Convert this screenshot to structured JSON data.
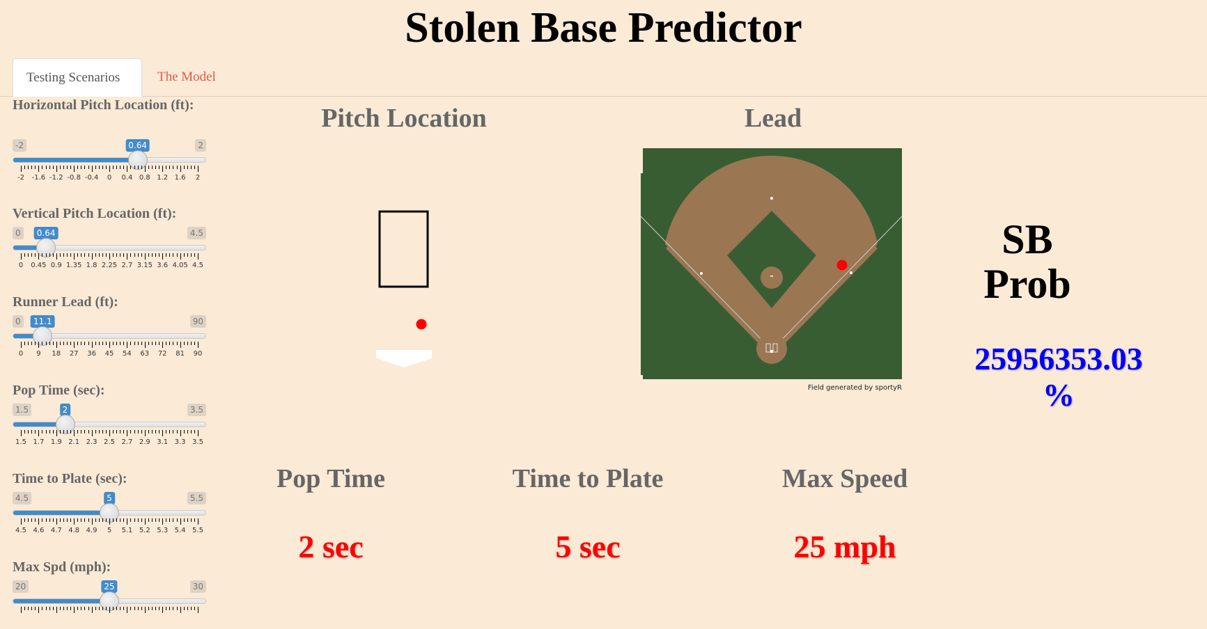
{
  "app": {
    "title": "Stolen Base Predictor"
  },
  "tabs": [
    {
      "label": "Testing Scenarios",
      "active": true
    },
    {
      "label": "The Model",
      "active": false
    }
  ],
  "sliders": [
    {
      "label": "Horizontal Pitch Location (ft):",
      "min": -2,
      "max": 2,
      "value": 0.64,
      "min_label": "-2",
      "max_label": "2",
      "value_label": "0.64",
      "ticks": [
        "-2",
        "-1.6",
        "-1.2",
        "-0.8",
        "-0.4",
        "0",
        "0.4",
        "0.8",
        "1.2",
        "1.6",
        "2"
      ]
    },
    {
      "label": "Vertical Pitch Location (ft):",
      "min": 0,
      "max": 4.5,
      "value": 0.64,
      "min_label": "0",
      "max_label": "4.5",
      "value_label": "0.64",
      "ticks": [
        "0",
        "0.45",
        "0.9",
        "1.35",
        "1.8",
        "2.25",
        "2.7",
        "3.15",
        "3.6",
        "4.05",
        "4.5"
      ]
    },
    {
      "label": "Runner Lead (ft):",
      "min": 0,
      "max": 90,
      "value": 11.1,
      "min_label": "0",
      "max_label": "90",
      "value_label": "11.1",
      "ticks": [
        "0",
        "9",
        "18",
        "27",
        "36",
        "45",
        "54",
        "63",
        "72",
        "81",
        "90"
      ]
    },
    {
      "label": "Pop Time (sec):",
      "min": 1.5,
      "max": 3.5,
      "value": 2,
      "min_label": "1.5",
      "max_label": "3.5",
      "value_label": "2",
      "ticks": [
        "1.5",
        "1.7",
        "1.9",
        "2.1",
        "2.3",
        "2.5",
        "2.7",
        "2.9",
        "3.1",
        "3.3",
        "3.5"
      ]
    },
    {
      "label": "Time to Plate (sec):",
      "min": 4.5,
      "max": 5.5,
      "value": 5,
      "min_label": "4.5",
      "max_label": "5.5",
      "value_label": "5",
      "ticks": [
        "4.5",
        "4.6",
        "4.7",
        "4.8",
        "4.9",
        "5",
        "5.1",
        "5.2",
        "5.3",
        "5.4",
        "5.5"
      ]
    },
    {
      "label": "Max Spd (mph):",
      "min": 20,
      "max": 30,
      "value": 25,
      "min_label": "20",
      "max_label": "30",
      "value_label": "25",
      "ticks": []
    }
  ],
  "panels": {
    "pitch_location": {
      "title": "Pitch Location"
    },
    "lead": {
      "title": "Lead",
      "caption": "Field generated by sportyR"
    },
    "sb_prob": {
      "label": "SB Prob",
      "value": "25956353.03 %"
    }
  },
  "metrics": [
    {
      "title": "Pop Time",
      "value": "2 sec"
    },
    {
      "title": "Time to Plate",
      "value": "5 sec"
    },
    {
      "title": "Max Speed",
      "value": "25 mph"
    }
  ],
  "colors": {
    "background": "#faead6",
    "slider_accent": "#428bca",
    "metric_value": "#ff0000",
    "prob_value": "#0000ff",
    "tab_inactive": "#e05a4a",
    "field_grass": "#395d33",
    "field_dirt": "#9b7653",
    "pitch_marker": "#ff0000"
  }
}
